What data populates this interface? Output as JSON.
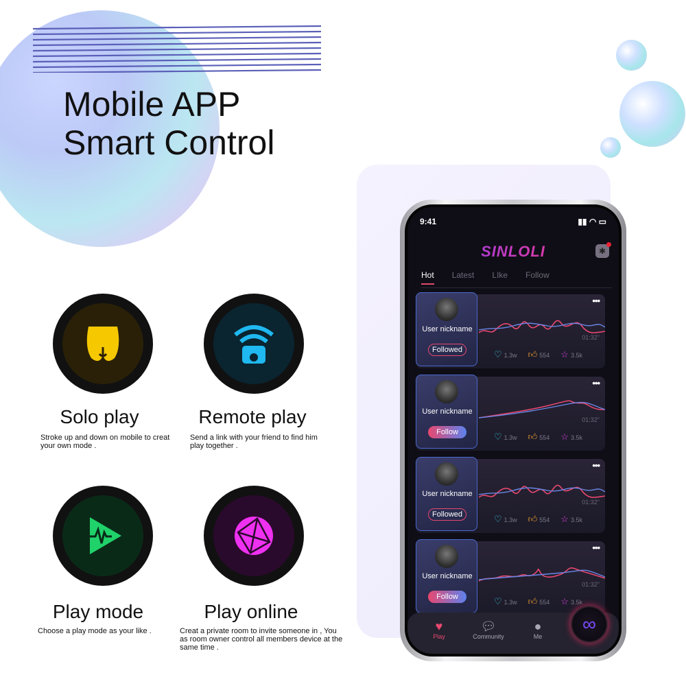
{
  "headline": {
    "line1": "Mobile APP",
    "line2": "Smart Control"
  },
  "features": [
    {
      "title": "Solo play",
      "desc": "Stroke up and down on mobile to creat your own mode .",
      "icon": "buttocks-icon",
      "color": "#f5c800"
    },
    {
      "title": "Remote play",
      "desc": "Send a link with your friend to find him play together .",
      "icon": "remote-wifi-icon",
      "color": "#1fb8f0"
    },
    {
      "title": "Play mode",
      "desc": "Choose a play mode as your like .",
      "icon": "play-pulse-icon",
      "color": "#1fd26a"
    },
    {
      "title": "Play online",
      "desc": "Creat a private room to invite someone in , You as room owner control all members device at the same time .",
      "icon": "globe-network-icon",
      "color": "#ee30f0"
    }
  ],
  "phone": {
    "time": "9:41",
    "logo": "SINLOLI",
    "tabs": [
      "Hot",
      "Latest",
      "LIke",
      "Follow"
    ],
    "active_tab": "Hot",
    "cards": [
      {
        "nickname": "User nickname",
        "button": "Followed",
        "duration": "01:32\"",
        "hearts": "1.3w",
        "likes": "554",
        "stars": "3.5k"
      },
      {
        "nickname": "User nickname",
        "button": "Follow",
        "duration": "01:32\"",
        "hearts": "1.3w",
        "likes": "554",
        "stars": "3.5k"
      },
      {
        "nickname": "User nickname",
        "button": "Followed",
        "duration": "01:32\"",
        "hearts": "1.3w",
        "likes": "554",
        "stars": "3.5k"
      },
      {
        "nickname": "User nickname",
        "button": "Follow",
        "duration": "01:32\"",
        "hearts": "1.3w",
        "likes": "554",
        "stars": "3.5k"
      }
    ],
    "tabbar": [
      {
        "label": "Play",
        "icon": "heart-pulse-icon",
        "active": true
      },
      {
        "label": "Community",
        "icon": "chat-icon"
      },
      {
        "label": "Me",
        "icon": "person-icon"
      }
    ],
    "accent": "#e8486f"
  }
}
